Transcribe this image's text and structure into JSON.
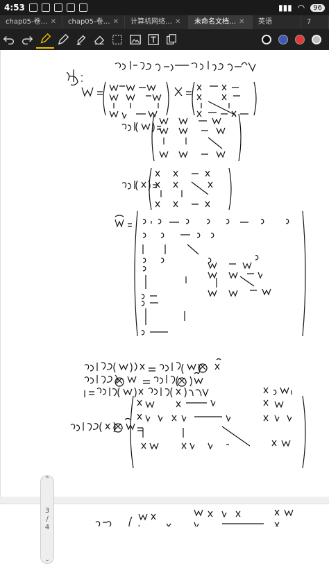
{
  "statusbar": {
    "time": "4:53",
    "battery": "96"
  },
  "tabs": [
    {
      "label": "chap05-卷…",
      "active": false
    },
    {
      "label": "chap05-卷…",
      "active": false
    },
    {
      "label": "计算机网络…",
      "active": false
    },
    {
      "label": "未命名文档…",
      "active": true
    },
    {
      "label": "英语",
      "active": false
    },
    {
      "label": "7",
      "active": false
    }
  ],
  "toolbar": {
    "tools": [
      "undo-icon",
      "redo-icon",
      "pen-icon",
      "pencil-icon",
      "highlighter-icon",
      "eraser-icon",
      "lasso-icon",
      "image-icon",
      "text-icon",
      "copy-icon"
    ],
    "colors": [
      "#111111",
      "#3f59b5",
      "#e53935",
      "#bdbdbd"
    ]
  },
  "pager": {
    "current": "3",
    "sep": "/",
    "total": "4"
  }
}
